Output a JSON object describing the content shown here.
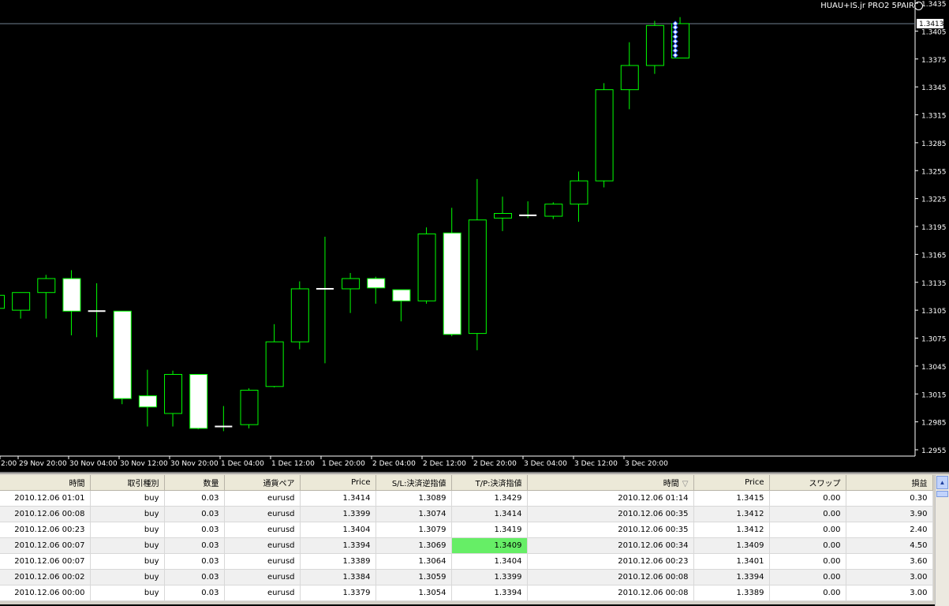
{
  "chart": {
    "title": "HUAU+IS.jr PRO2 5PAIR",
    "current_price_label": "1.3413",
    "colors": {
      "background": "#000000",
      "bull": "#00ff00",
      "bear_fill": "#ffffff",
      "grid_line": "#708090",
      "hl_cell": "#66ee66"
    },
    "y_axis_labels": [
      "1.3435",
      "1.3405",
      "1.3375",
      "1.3345",
      "1.3315",
      "1.3285",
      "1.3255",
      "1.3225",
      "1.3195",
      "1.3165",
      "1.3135",
      "1.3105",
      "1.3075",
      "1.3045",
      "1.3015",
      "1.2985",
      "1.2955"
    ],
    "x_axis_labels": [
      "2:00",
      "29 Nov 20:00",
      "30 Nov 04:00",
      "30 Nov 12:00",
      "30 Nov 20:00",
      "1 Dec 04:00",
      "1 Dec 12:00",
      "1 Dec 20:00",
      "2 Dec 04:00",
      "2 Dec 12:00",
      "2 Dec 20:00",
      "3 Dec 04:00",
      "3 Dec 12:00",
      "3 Dec 20:00"
    ]
  },
  "chart_data": {
    "type": "candlestick",
    "ylim": [
      1.2955,
      1.3435
    ],
    "current_price": 1.3413,
    "candles": [
      {
        "o": 1.3107,
        "h": 1.3121,
        "l": 1.31,
        "c": 1.3121
      },
      {
        "o": 1.3105,
        "h": 1.3124,
        "l": 1.3096,
        "c": 1.3124
      },
      {
        "o": 1.3124,
        "h": 1.3143,
        "l": 1.3096,
        "c": 1.3139
      },
      {
        "o": 1.3139,
        "h": 1.3148,
        "l": 1.3078,
        "c": 1.3104
      },
      {
        "o": 1.3104,
        "h": 1.3134,
        "l": 1.3076,
        "c": 1.3104
      },
      {
        "o": 1.3104,
        "h": 1.3104,
        "l": 1.3004,
        "c": 1.301
      },
      {
        "o": 1.3013,
        "h": 1.3041,
        "l": 1.298,
        "c": 1.3001
      },
      {
        "o": 1.2994,
        "h": 1.304,
        "l": 1.298,
        "c": 1.3036
      },
      {
        "o": 1.3036,
        "h": 1.3036,
        "l": 1.2977,
        "c": 1.2978
      },
      {
        "o": 1.298,
        "h": 1.3002,
        "l": 1.2975,
        "c": 1.298
      },
      {
        "o": 1.2982,
        "h": 1.3021,
        "l": 1.2978,
        "c": 1.3019
      },
      {
        "o": 1.3023,
        "h": 1.309,
        "l": 1.3022,
        "c": 1.3071
      },
      {
        "o": 1.3071,
        "h": 1.3136,
        "l": 1.3063,
        "c": 1.3128
      },
      {
        "o": 1.3128,
        "h": 1.3184,
        "l": 1.3048,
        "c": 1.3128
      },
      {
        "o": 1.3128,
        "h": 1.3145,
        "l": 1.3102,
        "c": 1.3139
      },
      {
        "o": 1.3139,
        "h": 1.3141,
        "l": 1.3112,
        "c": 1.3129
      },
      {
        "o": 1.3127,
        "h": 1.3127,
        "l": 1.3093,
        "c": 1.3115
      },
      {
        "o": 1.3115,
        "h": 1.3194,
        "l": 1.3112,
        "c": 1.3187
      },
      {
        "o": 1.3188,
        "h": 1.3215,
        "l": 1.3077,
        "c": 1.3079
      },
      {
        "o": 1.308,
        "h": 1.3246,
        "l": 1.3062,
        "c": 1.3202
      },
      {
        "o": 1.3204,
        "h": 1.3227,
        "l": 1.319,
        "c": 1.3209
      },
      {
        "o": 1.3207,
        "h": 1.3222,
        "l": 1.3204,
        "c": 1.3207
      },
      {
        "o": 1.3206,
        "h": 1.3221,
        "l": 1.3203,
        "c": 1.3219
      },
      {
        "o": 1.3219,
        "h": 1.3254,
        "l": 1.32,
        "c": 1.3244
      },
      {
        "o": 1.3244,
        "h": 1.3349,
        "l": 1.3237,
        "c": 1.3342
      },
      {
        "o": 1.3342,
        "h": 1.3393,
        "l": 1.3321,
        "c": 1.3368
      },
      {
        "o": 1.3368,
        "h": 1.3416,
        "l": 1.3359,
        "c": 1.3411
      },
      {
        "o": 1.3376,
        "h": 1.342,
        "l": 1.3376,
        "c": 1.3413
      }
    ],
    "markers": [
      1.3413,
      1.3409,
      1.3404,
      1.3399,
      1.3394,
      1.3389,
      1.3384,
      1.3379
    ]
  },
  "table": {
    "headers": [
      "時間",
      "取引種別",
      "数量",
      "通貨ペア",
      "Price",
      "S/L:決済逆指値",
      "T/P:決済指値",
      "時間",
      "Price",
      "スワップ",
      "損益"
    ],
    "sort_indicator": "▽",
    "rows": [
      [
        "2010.12.06 01:01",
        "buy",
        "0.03",
        "eurusd",
        "1.3414",
        "1.3089",
        "1.3429",
        "2010.12.06 01:14",
        "1.3415",
        "0.00",
        "0.30"
      ],
      [
        "2010.12.06 00:08",
        "buy",
        "0.03",
        "eurusd",
        "1.3399",
        "1.3074",
        "1.3414",
        "2010.12.06 00:35",
        "1.3412",
        "0.00",
        "3.90"
      ],
      [
        "2010.12.06 00:23",
        "buy",
        "0.03",
        "eurusd",
        "1.3404",
        "1.3079",
        "1.3419",
        "2010.12.06 00:35",
        "1.3412",
        "0.00",
        "2.40"
      ],
      [
        "2010.12.06 00:07",
        "buy",
        "0.03",
        "eurusd",
        "1.3394",
        "1.3069",
        "1.3409",
        "2010.12.06 00:34",
        "1.3409",
        "0.00",
        "4.50"
      ],
      [
        "2010.12.06 00:07",
        "buy",
        "0.03",
        "eurusd",
        "1.3389",
        "1.3064",
        "1.3404",
        "2010.12.06 00:23",
        "1.3401",
        "0.00",
        "3.60"
      ],
      [
        "2010.12.06 00:02",
        "buy",
        "0.03",
        "eurusd",
        "1.3384",
        "1.3059",
        "1.3399",
        "2010.12.06 00:08",
        "1.3394",
        "0.00",
        "3.00"
      ],
      [
        "2010.12.06 00:00",
        "buy",
        "0.03",
        "eurusd",
        "1.3379",
        "1.3054",
        "1.3394",
        "2010.12.06 00:08",
        "1.3389",
        "0.00",
        "3.00"
      ]
    ],
    "highlight": {
      "row": 3,
      "col": 6
    }
  }
}
